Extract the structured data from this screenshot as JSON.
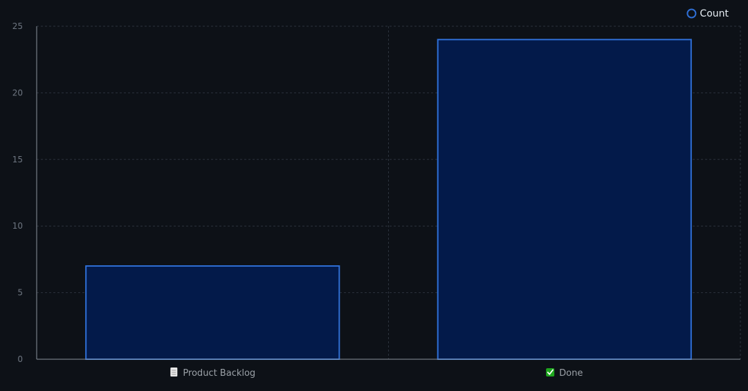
{
  "chart_data": {
    "type": "bar",
    "categories": [
      "Product Backlog",
      "Done"
    ],
    "category_icons": [
      "page-icon",
      "checkbox-checked-icon"
    ],
    "series": [
      {
        "name": "Count",
        "values": [
          7,
          24
        ]
      }
    ],
    "ylim": [
      0,
      25
    ],
    "yticks": [
      "0",
      "5",
      "10",
      "15",
      "20",
      "25"
    ],
    "grid": true,
    "legend_position": "top-right"
  },
  "colors": {
    "background": "#0d1117",
    "bar_fill": "#031a4a",
    "bar_stroke": "#2f6fd6",
    "grid": "#2c333d",
    "axis": "#8b949e",
    "tick_text": "#6e7681",
    "label_text": "#9aa0a6",
    "legend_text": "#e6edf3",
    "done_icon": "#1ea61e"
  }
}
